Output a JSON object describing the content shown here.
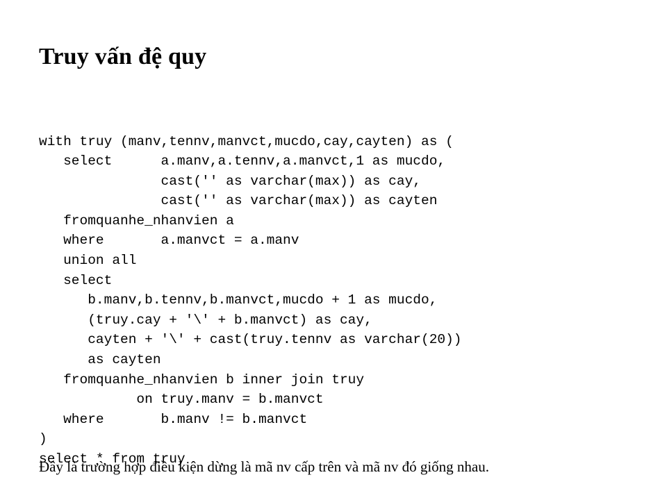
{
  "slide": {
    "title": "Truy vấn đệ quy",
    "background_color": "#ffffff",
    "text_color": "#000000"
  },
  "code": {
    "language": "sql",
    "lines": [
      "with truy (manv,tennv,manvct,mucdo,cay,cayten) as (",
      "   select      a.manv,a.tennv,a.manvct,1 as mucdo,",
      "               cast('' as varchar(max)) as cay,",
      "               cast('' as varchar(max)) as cayten",
      "   fromquanhe_nhanvien a",
      "   where       a.manvct = a.manv",
      "   union all",
      "   select",
      "      b.manv,b.tennv,b.manvct,mucdo + 1 as mucdo,",
      "      (truy.cay + '\\' + b.manvct) as cay,",
      "      cayten + '\\' + cast(truy.tennv as varchar(20))",
      "      as cayten",
      "   fromquanhe_nhanvien b inner join truy",
      "            on truy.manv = b.manvct",
      "   where       b.manv != b.manvct",
      ")",
      "select * from truy"
    ]
  },
  "note": {
    "text": "Đây là trường hợp điều kiện dừng là mã nv cấp trên và mã nv đó giống nhau."
  }
}
